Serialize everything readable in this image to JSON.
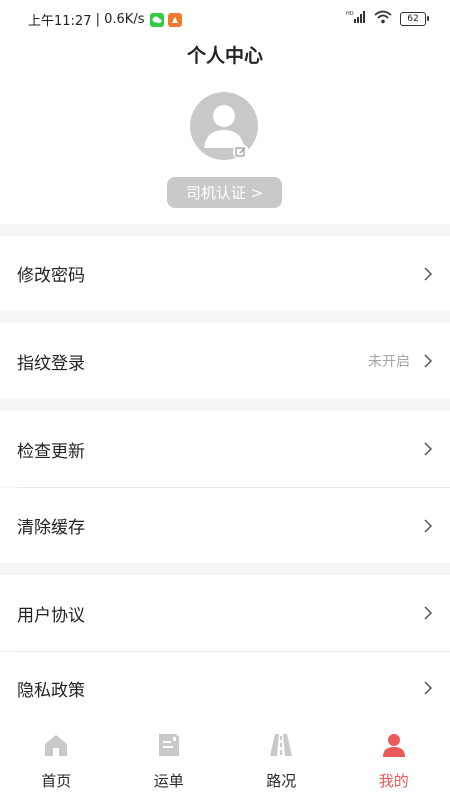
{
  "status_bar": {
    "time": "上午11:27",
    "speed": "0.6K/s",
    "battery": "62",
    "network_label": "HD"
  },
  "header": {
    "title": "个人中心",
    "verify_button": "司机认证 >"
  },
  "menu": [
    {
      "label": "修改密码",
      "value": ""
    },
    {
      "label": "指纹登录",
      "value": "未开启"
    },
    {
      "label": "检查更新",
      "value": ""
    },
    {
      "label": "清除缓存",
      "value": ""
    },
    {
      "label": "用户协议",
      "value": ""
    },
    {
      "label": "隐私政策",
      "value": ""
    }
  ],
  "tabs": [
    {
      "label": "首页",
      "icon": "home-icon"
    },
    {
      "label": "运单",
      "icon": "waybill-icon"
    },
    {
      "label": "路况",
      "icon": "road-icon"
    },
    {
      "label": "我的",
      "icon": "profile-icon",
      "active": true
    }
  ],
  "colors": {
    "accent": "#ea5a5a",
    "inactive_icon": "#c9c9c9",
    "background": "#f5f5f5"
  }
}
